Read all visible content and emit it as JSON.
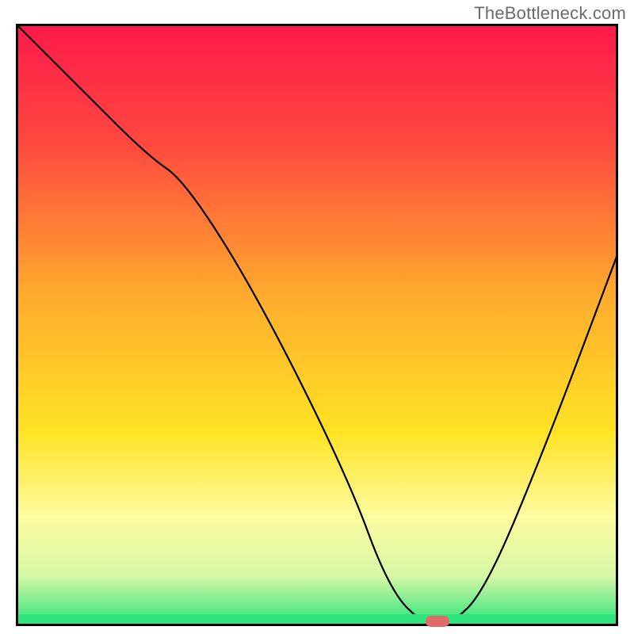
{
  "watermark": "TheBottleneck.com",
  "marker_color": "#e06a6a",
  "chart_data": {
    "type": "line",
    "title": "",
    "xlabel": "",
    "ylabel": "",
    "xlim": [
      0,
      100
    ],
    "ylim": [
      0,
      100
    ],
    "series": [
      {
        "name": "bottleneck-curve",
        "x": [
          0,
          10,
          22,
          28,
          40,
          55,
          62,
          68,
          72,
          78,
          88,
          100
        ],
        "y": [
          100,
          90,
          78,
          74,
          55,
          25,
          6,
          0,
          0,
          6,
          30,
          62
        ]
      }
    ],
    "optimum_marker": {
      "x": 70,
      "y": 0.8
    },
    "gradient_stops": [
      {
        "offset": 0,
        "color": "#ff1a4b"
      },
      {
        "offset": 20,
        "color": "#ff4a3f"
      },
      {
        "offset": 45,
        "color": "#ffab2e"
      },
      {
        "offset": 68,
        "color": "#ffe324"
      },
      {
        "offset": 82,
        "color": "#fdfca0"
      },
      {
        "offset": 92,
        "color": "#d8f7a8"
      },
      {
        "offset": 100,
        "color": "#2fe47a"
      }
    ]
  }
}
